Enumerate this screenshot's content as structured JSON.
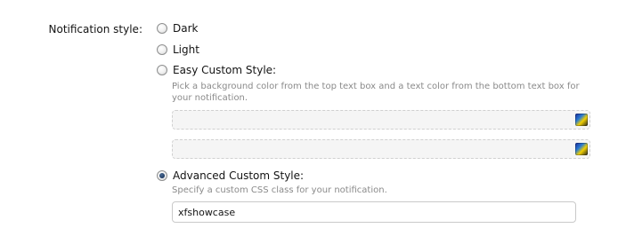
{
  "notification_style": {
    "label": "Notification style:",
    "options": [
      {
        "label": "Dark",
        "checked": false
      },
      {
        "label": "Light",
        "checked": false
      },
      {
        "label": "Easy Custom Style:",
        "checked": false
      },
      {
        "label": "Advanced Custom Style:",
        "checked": true
      }
    ],
    "easy_custom_hint": "Pick a background color from the top text box and a text color from the bottom text box for your notification.",
    "background_color_value": "",
    "text_color_value": "",
    "advanced_custom_hint": "Specify a custom CSS class for your notification.",
    "custom_css_class_value": "xfshowcase"
  },
  "icons": {
    "color_picker": "color-picker-icon"
  },
  "colors": {
    "label_text": "#141414",
    "hint_text": "#8a8a8a",
    "radio_checked": "#203c63"
  }
}
